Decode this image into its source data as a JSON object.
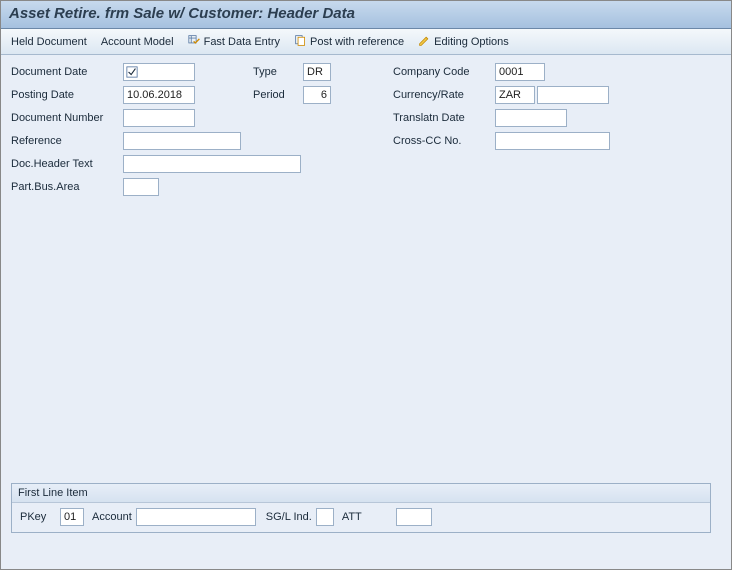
{
  "window": {
    "title": "Asset Retire. frm Sale w/ Customer: Header Data"
  },
  "toolbar": {
    "held_document": "Held Document",
    "account_model": "Account Model",
    "fast_data_entry": "Fast Data Entry",
    "post_with_reference": "Post with reference",
    "editing_options": "Editing Options"
  },
  "fields": {
    "document_date": {
      "label": "Document Date",
      "value": ""
    },
    "posting_date": {
      "label": "Posting Date",
      "value": "10.06.2018"
    },
    "document_number": {
      "label": "Document Number",
      "value": ""
    },
    "reference": {
      "label": "Reference",
      "value": ""
    },
    "doc_header_text": {
      "label": "Doc.Header Text",
      "value": ""
    },
    "part_bus_area": {
      "label": "Part.Bus.Area",
      "value": ""
    },
    "type": {
      "label": "Type",
      "value": "DR"
    },
    "period": {
      "label": "Period",
      "value": "6"
    },
    "company_code": {
      "label": "Company Code",
      "value": "0001"
    },
    "currency_rate": {
      "label": "Currency/Rate",
      "value": "ZAR",
      "rate_value": ""
    },
    "translatn_date": {
      "label": "Translatn Date",
      "value": ""
    },
    "cross_cc_no": {
      "label": "Cross-CC No.",
      "value": ""
    }
  },
  "first_line_item": {
    "title": "First Line Item",
    "pkey_label": "PKey",
    "pkey_value": "01",
    "account_label": "Account",
    "account_value": "",
    "sgl_label": "SG/L Ind.",
    "sgl_value": "",
    "att_label": "ATT",
    "att_value": ""
  }
}
